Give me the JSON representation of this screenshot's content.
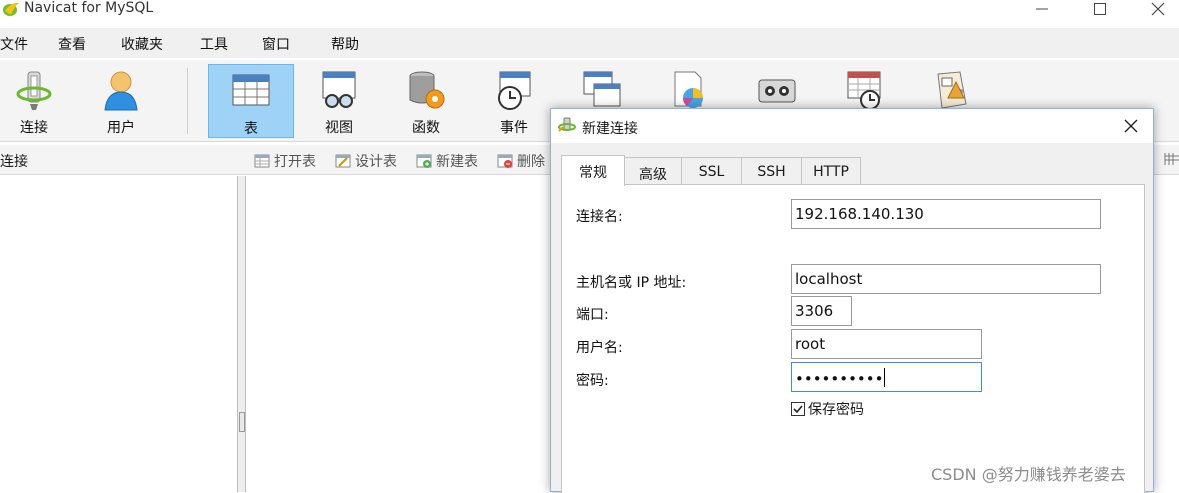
{
  "window": {
    "title": "Navicat for MySQL",
    "controls": [
      "minimize-icon",
      "maximize-icon",
      "close-icon"
    ]
  },
  "menubar": {
    "items": [
      "文件",
      "查看",
      "收藏夹",
      "工具",
      "窗口",
      "帮助"
    ]
  },
  "toolbar": {
    "items": [
      {
        "label": "连接",
        "icon": "connect-icon"
      },
      {
        "label": "用户",
        "icon": "user-icon"
      },
      {
        "label": "表",
        "icon": "table-icon",
        "active": true
      },
      {
        "label": "视图",
        "icon": "view-icon"
      },
      {
        "label": "函数",
        "icon": "function-icon"
      },
      {
        "label": "事件",
        "icon": "event-icon"
      }
    ]
  },
  "subbar": {
    "connection_label": "连接",
    "buttons": [
      "打开表",
      "设计表",
      "新建表",
      "删除"
    ]
  },
  "dialog": {
    "title": "新建连接",
    "tabs": [
      "常规",
      "高级",
      "SSL",
      "SSH",
      "HTTP"
    ],
    "active_tab": "常规",
    "fields": {
      "connection_name_label": "连接名:",
      "connection_name_value": "192.168.140.130",
      "host_label": "主机名或 IP 地址:",
      "host_value": "localhost",
      "port_label": "端口:",
      "port_value": "3306",
      "user_label": "用户名:",
      "user_value": "root",
      "password_label": "密码:",
      "password_mask": "••••••••••"
    },
    "save_password_label": "保存密码",
    "save_password_checked": true
  },
  "watermark": "CSDN @努力赚钱养老婆去",
  "colors": {
    "active_tool_bg": "#9fd2f7",
    "focus_border": "#3c8fd4",
    "menubar_bg": "#f0f0f0"
  }
}
